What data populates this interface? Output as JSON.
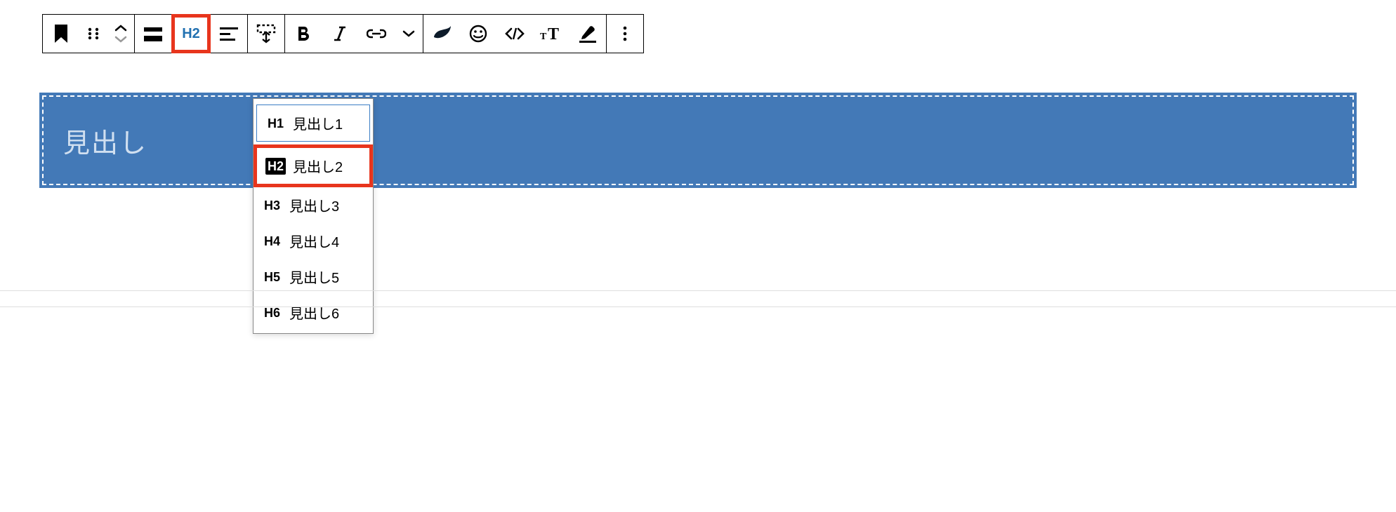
{
  "toolbar": {
    "heading_level_button": "H2"
  },
  "block": {
    "placeholder": "見出し"
  },
  "dropdown": {
    "items": [
      {
        "badge": "H1",
        "label": "見出し1"
      },
      {
        "badge": "H2",
        "label": "見出し2"
      },
      {
        "badge": "H3",
        "label": "見出し3"
      },
      {
        "badge": "H4",
        "label": "見出し4"
      },
      {
        "badge": "H5",
        "label": "見出し5"
      },
      {
        "badge": "H6",
        "label": "見出し6"
      }
    ]
  }
}
